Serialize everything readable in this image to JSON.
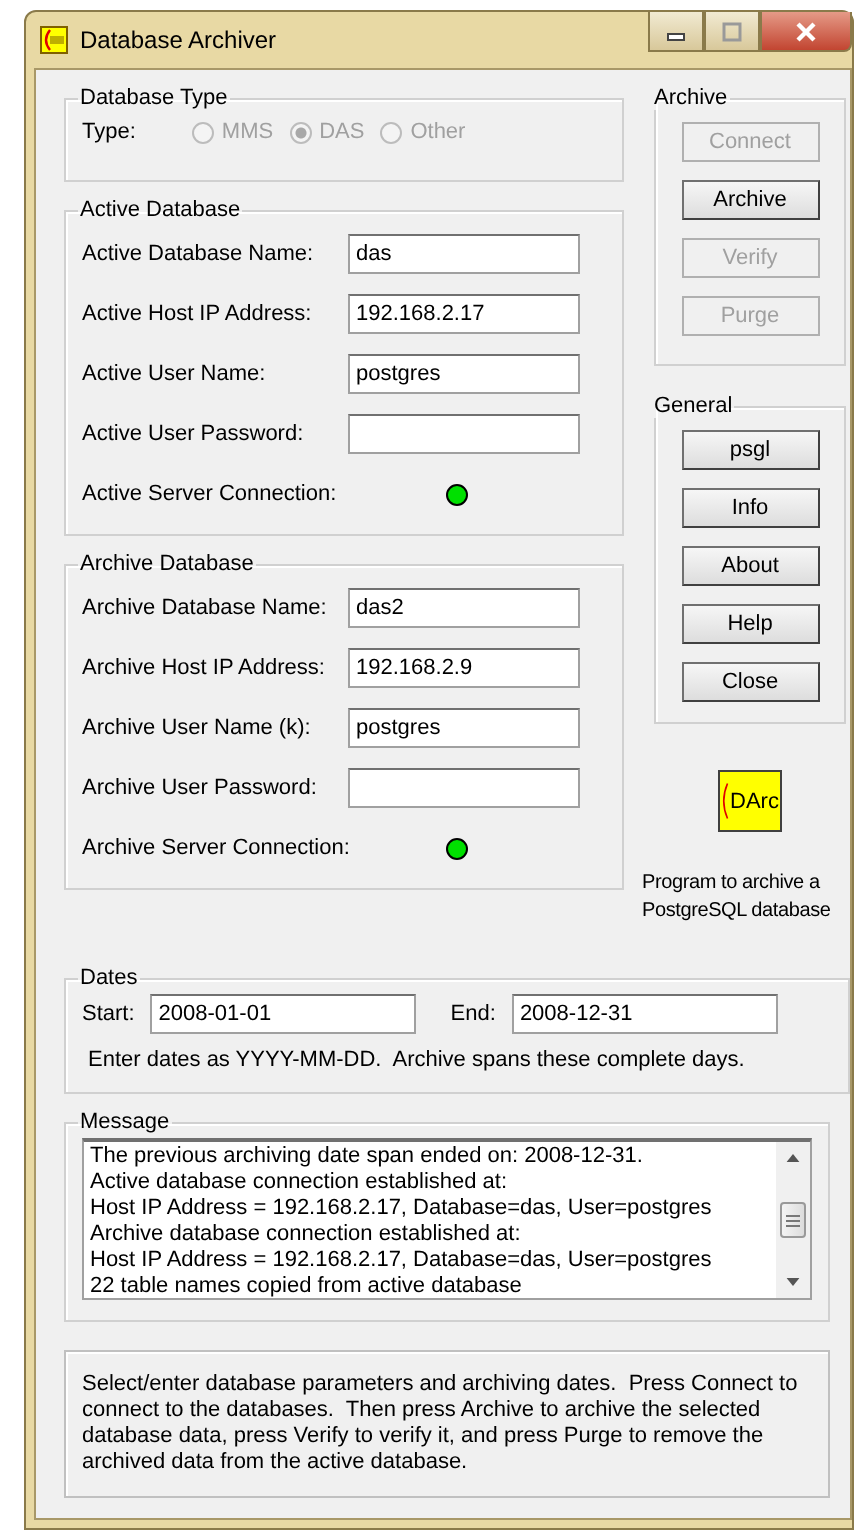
{
  "window": {
    "title": "Database Archiver"
  },
  "database_type": {
    "legend": "Database Type",
    "label": "Type:",
    "options": [
      {
        "label": "MMS",
        "selected": false,
        "disabled": true
      },
      {
        "label": "DAS",
        "selected": true,
        "disabled": true
      },
      {
        "label": "Other",
        "selected": false,
        "disabled": true
      }
    ]
  },
  "active_database": {
    "legend": "Active Database",
    "fields": [
      {
        "label": "Active Database Name:",
        "value": "das"
      },
      {
        "label": "Active Host IP Address:",
        "value": "192.168.2.17"
      },
      {
        "label": "Active User Name:",
        "value": "postgres"
      },
      {
        "label": "Active User Password:"
      }
    ],
    "connection": {
      "label": "Active Server Connection:",
      "on": true
    }
  },
  "archive_database": {
    "legend": "Archive Database",
    "fields": [
      {
        "label": "Archive Database Name:",
        "value": "das2"
      },
      {
        "label": "Archive Host IP Address:",
        "value": "192.168.2.9"
      },
      {
        "label": "Archive User Name (k):",
        "value": "postgres"
      },
      {
        "label": "Archive User Password:"
      }
    ],
    "connection": {
      "label": "Archive Server Connection:",
      "on": true
    }
  },
  "archive": {
    "legend": "Archive",
    "buttons": [
      {
        "label": "Connect",
        "disabled": true
      },
      {
        "label": "Archive",
        "disabled": false
      },
      {
        "label": "Verify",
        "disabled": true
      },
      {
        "label": "Purge",
        "disabled": true
      }
    ]
  },
  "general": {
    "legend": "General",
    "buttons": [
      {
        "label": "psgl",
        "disabled": false
      },
      {
        "label": "Info",
        "disabled": false
      },
      {
        "label": "About",
        "disabled": false
      },
      {
        "label": "Help",
        "disabled": false
      },
      {
        "label": "Close",
        "disabled": false
      }
    ]
  },
  "logo": {
    "text": "DArc"
  },
  "tagline": "Program to archive a\nPostgreSQL database",
  "dates": {
    "legend": "Dates",
    "start": {
      "label": "Start:",
      "value": "2008-01-01"
    },
    "end": {
      "label": "End:",
      "value": "2008-12-31"
    },
    "hint": "Enter dates as YYYY-MM-DD.  Archive spans these complete days."
  },
  "message": {
    "legend": "Message",
    "lines": [
      "The previous archiving date span ended on: 2008-12-31.",
      "Active database connection established at:",
      "Host IP Address = 192.168.2.17, Database=das, User=postgres",
      "Archive database connection established at:",
      "Host IP Address = 192.168.2.17, Database=das, User=postgres",
      "22 table names copied from active database"
    ]
  },
  "instructions": "Select/enter database parameters and archiving dates.  Press Connect to connect to the databases.  Then press Archive to archive the selected database data, press Verify to verify it, and press Purge to remove the archived data from the active database."
}
